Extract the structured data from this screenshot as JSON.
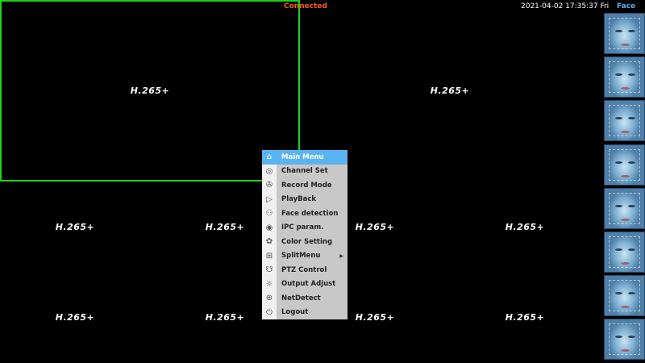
{
  "status": "Connected",
  "datetime": "2021-04-02 17:35:37 Fri",
  "face_panel": {
    "title": "Face",
    "thumbnail_count": 8
  },
  "channels": [
    {
      "codec": "H.265+",
      "selected": true
    },
    {
      "codec": "H.265+"
    },
    {
      "codec": "H.265+"
    },
    {
      "codec": "H.265+"
    },
    {
      "codec": "H.265+"
    },
    {
      "codec": "H.265+"
    },
    {
      "codec": "H.265+"
    },
    {
      "codec": "H.265+"
    },
    {
      "codec": "H.265+"
    },
    {
      "codec": "H.265+"
    }
  ],
  "menu": {
    "items": [
      {
        "label": "Main Menu",
        "icon": "home-icon",
        "active": true
      },
      {
        "label": "Channel Set",
        "icon": "camera-settings-icon"
      },
      {
        "label": "Record Mode",
        "icon": "film-reel-icon"
      },
      {
        "label": "PlayBack",
        "icon": "play-icon"
      },
      {
        "label": "Face detection",
        "icon": "face-scan-icon"
      },
      {
        "label": "IPC param.",
        "icon": "ipc-icon"
      },
      {
        "label": "Color Setting",
        "icon": "palette-icon"
      },
      {
        "label": "SplitMenu",
        "icon": "grid-icon",
        "submenu": true
      },
      {
        "label": "PTZ Control",
        "icon": "ptz-camera-icon"
      },
      {
        "label": "Output Adjust",
        "icon": "brightness-icon"
      },
      {
        "label": "NetDetect",
        "icon": "globe-icon"
      },
      {
        "label": "Logout",
        "icon": "power-icon"
      }
    ]
  },
  "colors": {
    "selected_border": "#1ed21e",
    "status": "#ff5a1e",
    "accent": "#5ab4f0"
  }
}
